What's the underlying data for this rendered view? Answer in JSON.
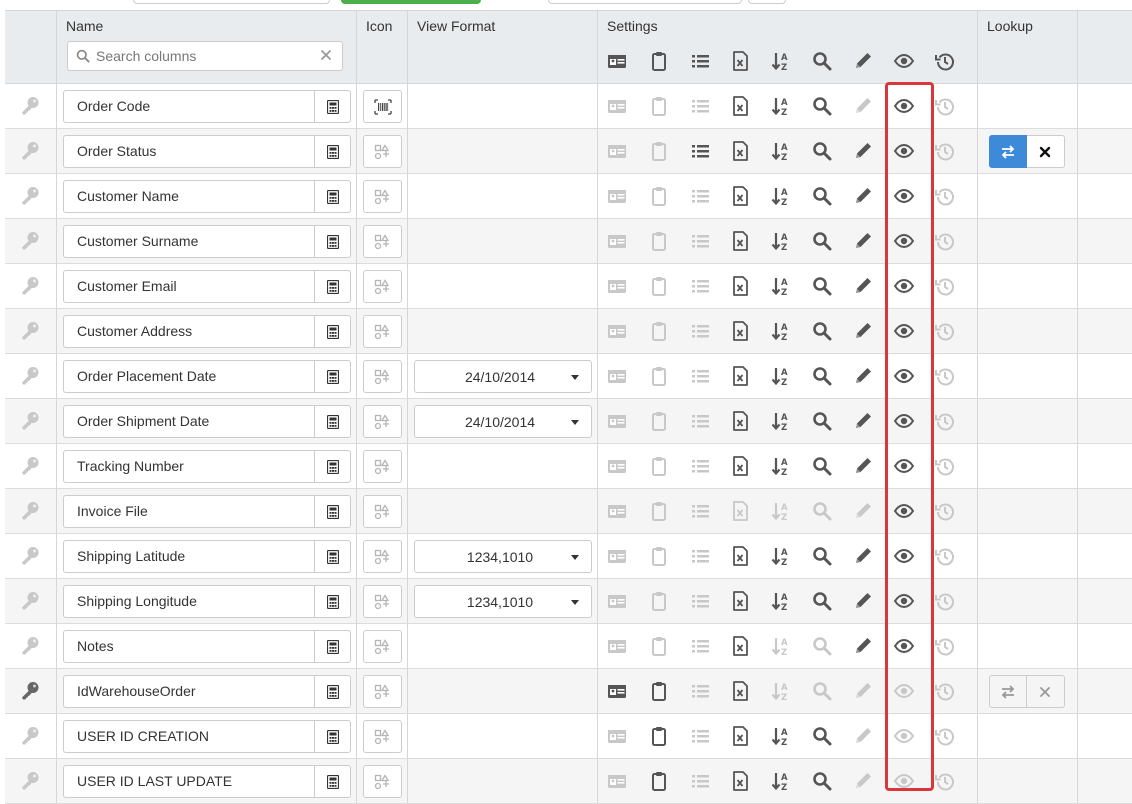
{
  "header": {
    "name_label": "Name",
    "icon_label": "Icon",
    "view_format_label": "View Format",
    "settings_label": "Settings",
    "lookup_label": "Lookup",
    "search_placeholder": "Search columns"
  },
  "settings_icons": [
    "id-card-icon",
    "clipboard-icon",
    "list-icon",
    "excel-file-icon",
    "sort-alpha-icon",
    "search-icon",
    "pencil-icon",
    "eye-icon",
    "history-icon"
  ],
  "colors": {
    "accent": "#3d8bd8",
    "highlight": "#d9363e",
    "active": "#555555",
    "inactive": "#c8c8c8",
    "header_bg": "#e9ecef"
  },
  "rows": [
    {
      "name": "Order Code",
      "icon": "barcode",
      "format": "",
      "key_dark": false,
      "settings": [
        0,
        0,
        0,
        1,
        1,
        1,
        0,
        1,
        0
      ],
      "lookup": "none"
    },
    {
      "name": "Order Status",
      "icon": "default",
      "format": "",
      "key_dark": false,
      "settings": [
        0,
        0,
        1,
        1,
        1,
        1,
        1,
        1,
        0
      ],
      "lookup": "active"
    },
    {
      "name": "Customer Name",
      "icon": "default",
      "format": "",
      "key_dark": false,
      "settings": [
        0,
        0,
        0,
        1,
        1,
        1,
        1,
        1,
        0
      ],
      "lookup": "none"
    },
    {
      "name": "Customer Surname",
      "icon": "default",
      "format": "",
      "key_dark": false,
      "settings": [
        0,
        0,
        0,
        1,
        1,
        1,
        1,
        1,
        0
      ],
      "lookup": "none"
    },
    {
      "name": "Customer Email",
      "icon": "default",
      "format": "",
      "key_dark": false,
      "settings": [
        0,
        0,
        0,
        1,
        1,
        1,
        1,
        1,
        0
      ],
      "lookup": "none"
    },
    {
      "name": "Customer Address",
      "icon": "default",
      "format": "",
      "key_dark": false,
      "settings": [
        0,
        0,
        0,
        1,
        1,
        1,
        1,
        1,
        0
      ],
      "lookup": "none"
    },
    {
      "name": "Order Placement Date",
      "icon": "default",
      "format": "24/10/2014",
      "key_dark": false,
      "settings": [
        0,
        0,
        0,
        1,
        1,
        1,
        1,
        1,
        0
      ],
      "lookup": "none"
    },
    {
      "name": "Order Shipment Date",
      "icon": "default",
      "format": "24/10/2014",
      "key_dark": false,
      "settings": [
        0,
        0,
        0,
        1,
        1,
        1,
        1,
        1,
        0
      ],
      "lookup": "none"
    },
    {
      "name": "Tracking Number",
      "icon": "default",
      "format": "",
      "key_dark": false,
      "settings": [
        0,
        0,
        0,
        1,
        1,
        1,
        1,
        1,
        0
      ],
      "lookup": "none"
    },
    {
      "name": "Invoice File",
      "icon": "default",
      "format": "",
      "key_dark": false,
      "settings": [
        0,
        0,
        0,
        0,
        0,
        0,
        0,
        1,
        0
      ],
      "lookup": "none"
    },
    {
      "name": "Shipping Latitude",
      "icon": "default",
      "format": "1234,1010",
      "key_dark": false,
      "settings": [
        0,
        0,
        0,
        1,
        1,
        1,
        1,
        1,
        0
      ],
      "lookup": "none"
    },
    {
      "name": "Shipping Longitude",
      "icon": "default",
      "format": "1234,1010",
      "key_dark": false,
      "settings": [
        0,
        0,
        0,
        1,
        1,
        1,
        1,
        1,
        0
      ],
      "lookup": "none"
    },
    {
      "name": "Notes",
      "icon": "default",
      "format": "",
      "key_dark": false,
      "settings": [
        0,
        0,
        0,
        1,
        0,
        0,
        1,
        1,
        0
      ],
      "lookup": "none"
    },
    {
      "name": "IdWarehouseOrder",
      "icon": "default",
      "format": "",
      "key_dark": true,
      "settings": [
        1,
        1,
        0,
        1,
        0,
        0,
        0,
        0,
        0
      ],
      "lookup": "disabled"
    },
    {
      "name": "USER ID CREATION",
      "icon": "default",
      "format": "",
      "key_dark": false,
      "settings": [
        0,
        1,
        0,
        1,
        1,
        1,
        0,
        0,
        0
      ],
      "lookup": "none"
    },
    {
      "name": "USER ID LAST UPDATE",
      "icon": "default",
      "format": "",
      "key_dark": false,
      "settings": [
        0,
        1,
        0,
        1,
        1,
        1,
        0,
        0,
        0
      ],
      "lookup": "none"
    }
  ]
}
